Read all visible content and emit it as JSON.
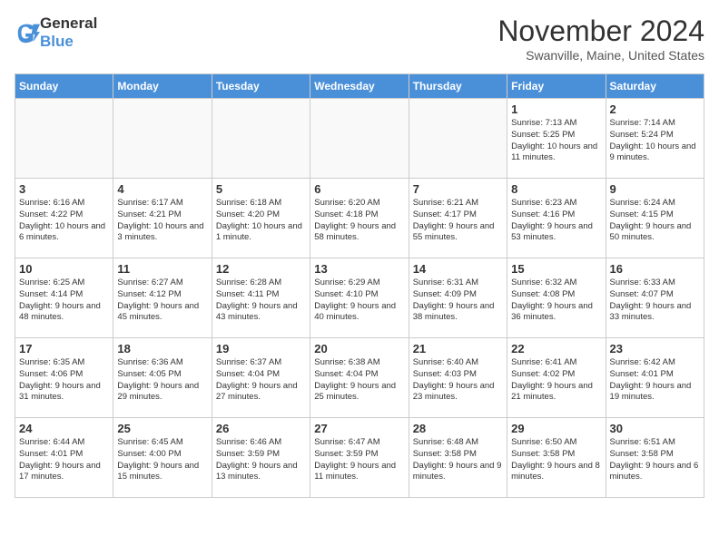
{
  "header": {
    "logo_general": "General",
    "logo_blue": "Blue",
    "month": "November 2024",
    "location": "Swanville, Maine, United States"
  },
  "weekdays": [
    "Sunday",
    "Monday",
    "Tuesday",
    "Wednesday",
    "Thursday",
    "Friday",
    "Saturday"
  ],
  "weeks": [
    [
      {
        "day": "",
        "info": ""
      },
      {
        "day": "",
        "info": ""
      },
      {
        "day": "",
        "info": ""
      },
      {
        "day": "",
        "info": ""
      },
      {
        "day": "",
        "info": ""
      },
      {
        "day": "1",
        "info": "Sunrise: 7:13 AM\nSunset: 5:25 PM\nDaylight: 10 hours and 11 minutes."
      },
      {
        "day": "2",
        "info": "Sunrise: 7:14 AM\nSunset: 5:24 PM\nDaylight: 10 hours and 9 minutes."
      }
    ],
    [
      {
        "day": "3",
        "info": "Sunrise: 6:16 AM\nSunset: 4:22 PM\nDaylight: 10 hours and 6 minutes."
      },
      {
        "day": "4",
        "info": "Sunrise: 6:17 AM\nSunset: 4:21 PM\nDaylight: 10 hours and 3 minutes."
      },
      {
        "day": "5",
        "info": "Sunrise: 6:18 AM\nSunset: 4:20 PM\nDaylight: 10 hours and 1 minute."
      },
      {
        "day": "6",
        "info": "Sunrise: 6:20 AM\nSunset: 4:18 PM\nDaylight: 9 hours and 58 minutes."
      },
      {
        "day": "7",
        "info": "Sunrise: 6:21 AM\nSunset: 4:17 PM\nDaylight: 9 hours and 55 minutes."
      },
      {
        "day": "8",
        "info": "Sunrise: 6:23 AM\nSunset: 4:16 PM\nDaylight: 9 hours and 53 minutes."
      },
      {
        "day": "9",
        "info": "Sunrise: 6:24 AM\nSunset: 4:15 PM\nDaylight: 9 hours and 50 minutes."
      }
    ],
    [
      {
        "day": "10",
        "info": "Sunrise: 6:25 AM\nSunset: 4:14 PM\nDaylight: 9 hours and 48 minutes."
      },
      {
        "day": "11",
        "info": "Sunrise: 6:27 AM\nSunset: 4:12 PM\nDaylight: 9 hours and 45 minutes."
      },
      {
        "day": "12",
        "info": "Sunrise: 6:28 AM\nSunset: 4:11 PM\nDaylight: 9 hours and 43 minutes."
      },
      {
        "day": "13",
        "info": "Sunrise: 6:29 AM\nSunset: 4:10 PM\nDaylight: 9 hours and 40 minutes."
      },
      {
        "day": "14",
        "info": "Sunrise: 6:31 AM\nSunset: 4:09 PM\nDaylight: 9 hours and 38 minutes."
      },
      {
        "day": "15",
        "info": "Sunrise: 6:32 AM\nSunset: 4:08 PM\nDaylight: 9 hours and 36 minutes."
      },
      {
        "day": "16",
        "info": "Sunrise: 6:33 AM\nSunset: 4:07 PM\nDaylight: 9 hours and 33 minutes."
      }
    ],
    [
      {
        "day": "17",
        "info": "Sunrise: 6:35 AM\nSunset: 4:06 PM\nDaylight: 9 hours and 31 minutes."
      },
      {
        "day": "18",
        "info": "Sunrise: 6:36 AM\nSunset: 4:05 PM\nDaylight: 9 hours and 29 minutes."
      },
      {
        "day": "19",
        "info": "Sunrise: 6:37 AM\nSunset: 4:04 PM\nDaylight: 9 hours and 27 minutes."
      },
      {
        "day": "20",
        "info": "Sunrise: 6:38 AM\nSunset: 4:04 PM\nDaylight: 9 hours and 25 minutes."
      },
      {
        "day": "21",
        "info": "Sunrise: 6:40 AM\nSunset: 4:03 PM\nDaylight: 9 hours and 23 minutes."
      },
      {
        "day": "22",
        "info": "Sunrise: 6:41 AM\nSunset: 4:02 PM\nDaylight: 9 hours and 21 minutes."
      },
      {
        "day": "23",
        "info": "Sunrise: 6:42 AM\nSunset: 4:01 PM\nDaylight: 9 hours and 19 minutes."
      }
    ],
    [
      {
        "day": "24",
        "info": "Sunrise: 6:44 AM\nSunset: 4:01 PM\nDaylight: 9 hours and 17 minutes."
      },
      {
        "day": "25",
        "info": "Sunrise: 6:45 AM\nSunset: 4:00 PM\nDaylight: 9 hours and 15 minutes."
      },
      {
        "day": "26",
        "info": "Sunrise: 6:46 AM\nSunset: 3:59 PM\nDaylight: 9 hours and 13 minutes."
      },
      {
        "day": "27",
        "info": "Sunrise: 6:47 AM\nSunset: 3:59 PM\nDaylight: 9 hours and 11 minutes."
      },
      {
        "day": "28",
        "info": "Sunrise: 6:48 AM\nSunset: 3:58 PM\nDaylight: 9 hours and 9 minutes."
      },
      {
        "day": "29",
        "info": "Sunrise: 6:50 AM\nSunset: 3:58 PM\nDaylight: 9 hours and 8 minutes."
      },
      {
        "day": "30",
        "info": "Sunrise: 6:51 AM\nSunset: 3:58 PM\nDaylight: 9 hours and 6 minutes."
      }
    ]
  ]
}
